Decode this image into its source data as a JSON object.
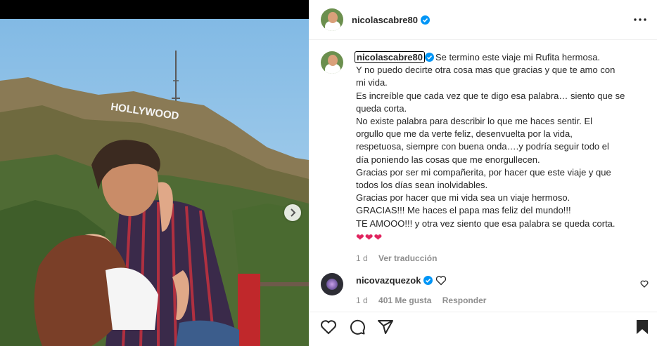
{
  "post": {
    "username": "nicolascabre80",
    "verified": true,
    "caption_lines": [
      "Se termino este viaje mi Rufita hermosa.",
      "Y no puedo decirte otra cosa mas que gracias y que te amo con",
      "mi vida.",
      "Es increíble que cada vez que te digo esa palabra… siento que se",
      "queda corta.",
      "No existe palabra para describir lo que me haces sentir. El",
      "orgullo que me da verte feliz, desenvuelta por la vida,",
      "respetuosa, siempre con buena onda….y podría seguir todo el",
      "día poniendo las cosas que me enorgullecen.",
      "Gracias por ser mi compañerita, por hacer que este viaje y que",
      "todos los días sean inolvidables.",
      "Gracias por hacer que mi vida sea un viaje hermoso.",
      "GRACIAS!!! Me haces el papa mas feliz del mundo!!!",
      "TE AMOOO!!! y otra vez siento que esa palabra se queda corta."
    ],
    "hearts": "❤❤❤",
    "time": "1 d",
    "translate_label": "Ver traducción"
  },
  "comment": {
    "username": "nicovazquezok",
    "verified": true,
    "time": "1 d",
    "likes": "401 Me gusta",
    "reply_label": "Responder"
  },
  "photo": {
    "sign_text": "HOLLYWOOD"
  },
  "icons": {
    "like": "heart-icon",
    "comment": "comment-icon",
    "share": "share-icon",
    "save": "bookmark-icon",
    "more": "more-icon",
    "next": "chevron-right-icon"
  },
  "colors": {
    "verified": "#0095f6",
    "secondary_text": "#8e8e8e",
    "heart_red": "#e0245e"
  }
}
